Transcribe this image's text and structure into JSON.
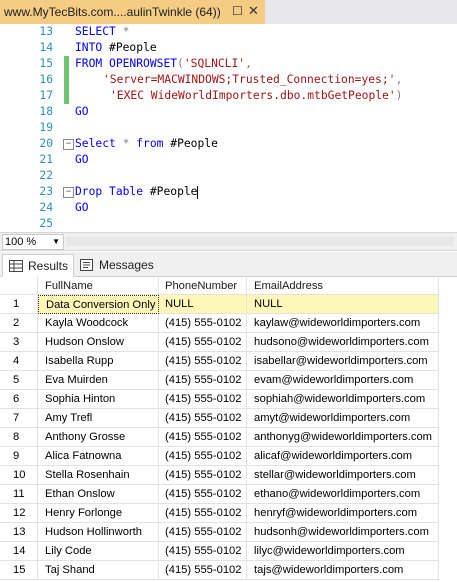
{
  "window": {
    "tab_title": "www.MyTecBits.com....aulinTwinkle (64))",
    "pin_icon": "pin-icon",
    "close_icon": "close-icon"
  },
  "editor": {
    "lines": [
      {
        "num": "13",
        "changed": false
      },
      {
        "num": "14",
        "changed": false
      },
      {
        "num": "15",
        "changed": true
      },
      {
        "num": "16",
        "changed": true
      },
      {
        "num": "17",
        "changed": true
      },
      {
        "num": "18",
        "changed": false
      },
      {
        "num": "19",
        "changed": false
      },
      {
        "num": "20",
        "changed": false
      },
      {
        "num": "21",
        "changed": false
      },
      {
        "num": "22",
        "changed": false
      },
      {
        "num": "23",
        "changed": false
      },
      {
        "num": "24",
        "changed": false
      },
      {
        "num": "25",
        "changed": false
      }
    ],
    "tokens": {
      "select": "SELECT",
      "star": "*",
      "into": "INTO",
      "people": "#People",
      "from": "FROM",
      "openrowset": "OPENROWSET",
      "lparen": "(",
      "sqlncli": "'SQLNCLI'",
      "comma": ",",
      "server": "'Server=MACWINDOWS;Trusted_Connection=yes;'",
      "exec": "'EXEC WideWorldImporters.dbo.mtbGetPeople'",
      "rparen": ")",
      "go": "GO",
      "select2": "Select",
      "from2": "from",
      "drop": "Drop",
      "table": "Table"
    }
  },
  "zoom": {
    "value": "100 %"
  },
  "results": {
    "tabs": [
      {
        "label": "Results",
        "icon": "grid-icon"
      },
      {
        "label": "Messages",
        "icon": "messages-icon"
      }
    ],
    "columns": [
      "FullName",
      "PhoneNumber",
      "EmailAddress"
    ],
    "rows": [
      {
        "n": "1",
        "name": "Data Conversion Only",
        "phone": "NULL",
        "email": "NULL"
      },
      {
        "n": "2",
        "name": "Kayla Woodcock",
        "phone": "(415) 555-0102",
        "email": "kaylaw@wideworldimporters.com"
      },
      {
        "n": "3",
        "name": "Hudson Onslow",
        "phone": "(415) 555-0102",
        "email": "hudsono@wideworldimporters.com"
      },
      {
        "n": "4",
        "name": "Isabella Rupp",
        "phone": "(415) 555-0102",
        "email": "isabellar@wideworldimporters.com"
      },
      {
        "n": "5",
        "name": "Eva Muirden",
        "phone": "(415) 555-0102",
        "email": "evam@wideworldimporters.com"
      },
      {
        "n": "6",
        "name": "Sophia Hinton",
        "phone": "(415) 555-0102",
        "email": "sophiah@wideworldimporters.com"
      },
      {
        "n": "7",
        "name": "Amy Trefl",
        "phone": "(415) 555-0102",
        "email": "amyt@wideworldimporters.com"
      },
      {
        "n": "8",
        "name": "Anthony Grosse",
        "phone": "(415) 555-0102",
        "email": "anthonyg@wideworldimporters.com"
      },
      {
        "n": "9",
        "name": "Alica Fatnowna",
        "phone": "(415) 555-0102",
        "email": "alicaf@wideworldimporters.com"
      },
      {
        "n": "10",
        "name": "Stella Rosenhain",
        "phone": "(415) 555-0102",
        "email": "stellar@wideworldimporters.com"
      },
      {
        "n": "11",
        "name": "Ethan Onslow",
        "phone": "(415) 555-0102",
        "email": "ethano@wideworldimporters.com"
      },
      {
        "n": "12",
        "name": "Henry Forlonge",
        "phone": "(415) 555-0102",
        "email": "henryf@wideworldimporters.com"
      },
      {
        "n": "13",
        "name": "Hudson Hollinworth",
        "phone": "(415) 555-0102",
        "email": "hudsonh@wideworldimporters.com"
      },
      {
        "n": "14",
        "name": "Lily Code",
        "phone": "(415) 555-0102",
        "email": "lilyc@wideworldimporters.com"
      },
      {
        "n": "15",
        "name": "Taj Shand",
        "phone": "(415) 555-0102",
        "email": "tajs@wideworldimporters.com"
      }
    ]
  },
  "colors": {
    "active_tab": "#f5cc84",
    "keyword": "#0000ff",
    "string": "#a31515",
    "line_number": "#2b91af",
    "change_marker": "#6cc46c",
    "selected_cell": "#fff7b8"
  }
}
